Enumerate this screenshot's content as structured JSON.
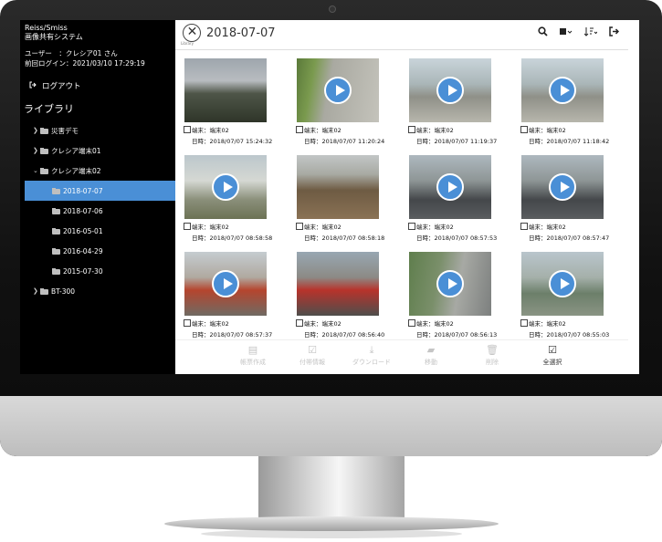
{
  "sidebar": {
    "app_line1": "Reiss/Smiss",
    "app_line2": "画像共有システム",
    "user": "ユーザー　：クレシア01 さん",
    "last_login": "前回ログイン：2021/03/10 17:29:19",
    "logout": "ログアウト",
    "library": "ライブラリ",
    "tree": [
      {
        "label": "災害デモ"
      },
      {
        "label": "クレシア端末01"
      },
      {
        "label": "クレシア端末02"
      },
      {
        "label": "2018-07-07"
      },
      {
        "label": "2018-07-06"
      },
      {
        "label": "2016-05-01"
      },
      {
        "label": "2016-04-29"
      },
      {
        "label": "2015-07-30"
      },
      {
        "label": "BT-300"
      }
    ]
  },
  "header": {
    "logo_sub": "Library",
    "title": "2018-07-07",
    "icons": [
      "search-icon",
      "view-mode-icon",
      "sort-icon",
      "exit-icon"
    ]
  },
  "items": [
    {
      "device": "端末：端末02",
      "date": "日時：2018/07/07 15:24:32",
      "video": false,
      "scene": "river"
    },
    {
      "device": "端末：端末02",
      "date": "日時：2018/07/07 11:20:24",
      "video": true,
      "scene": "road"
    },
    {
      "device": "端末：端末02",
      "date": "日時：2018/07/07 11:19:37",
      "video": true,
      "scene": "street"
    },
    {
      "device": "端末：端末02",
      "date": "日時：2018/07/07 11:18:42",
      "video": true,
      "scene": "street"
    },
    {
      "device": "端末：端末02",
      "date": "日時：2018/07/07 08:58:58",
      "video": true,
      "scene": "house"
    },
    {
      "device": "端末：端末02",
      "date": "日時：2018/07/07 08:58:18",
      "video": false,
      "scene": "flood"
    },
    {
      "device": "端末：端末02",
      "date": "日時：2018/07/07 08:57:53",
      "video": true,
      "scene": "hose"
    },
    {
      "device": "端末：端末02",
      "date": "日時：2018/07/07 08:57:47",
      "video": true,
      "scene": "hose"
    },
    {
      "device": "端末：端末02",
      "date": "日時：2018/07/07 08:57:37",
      "video": true,
      "scene": "truck"
    },
    {
      "device": "端末：端末02",
      "date": "日時：2018/07/07 08:56:40",
      "video": false,
      "scene": "truck2"
    },
    {
      "device": "端末：端末02",
      "date": "日時：2018/07/07 08:56:13",
      "video": true,
      "scene": "alley"
    },
    {
      "device": "端末：端末02",
      "date": "日時：2018/07/07 08:55:03",
      "video": true,
      "scene": "canal"
    }
  ],
  "toolbar": {
    "report": "帳票作成",
    "info": "付帯情報",
    "download": "ダウンロード",
    "move": "移動",
    "delete": "削除",
    "select_all": "全選択"
  },
  "colors": {
    "accent": "#4a8fd6",
    "sidebar_bg": "#000000"
  }
}
